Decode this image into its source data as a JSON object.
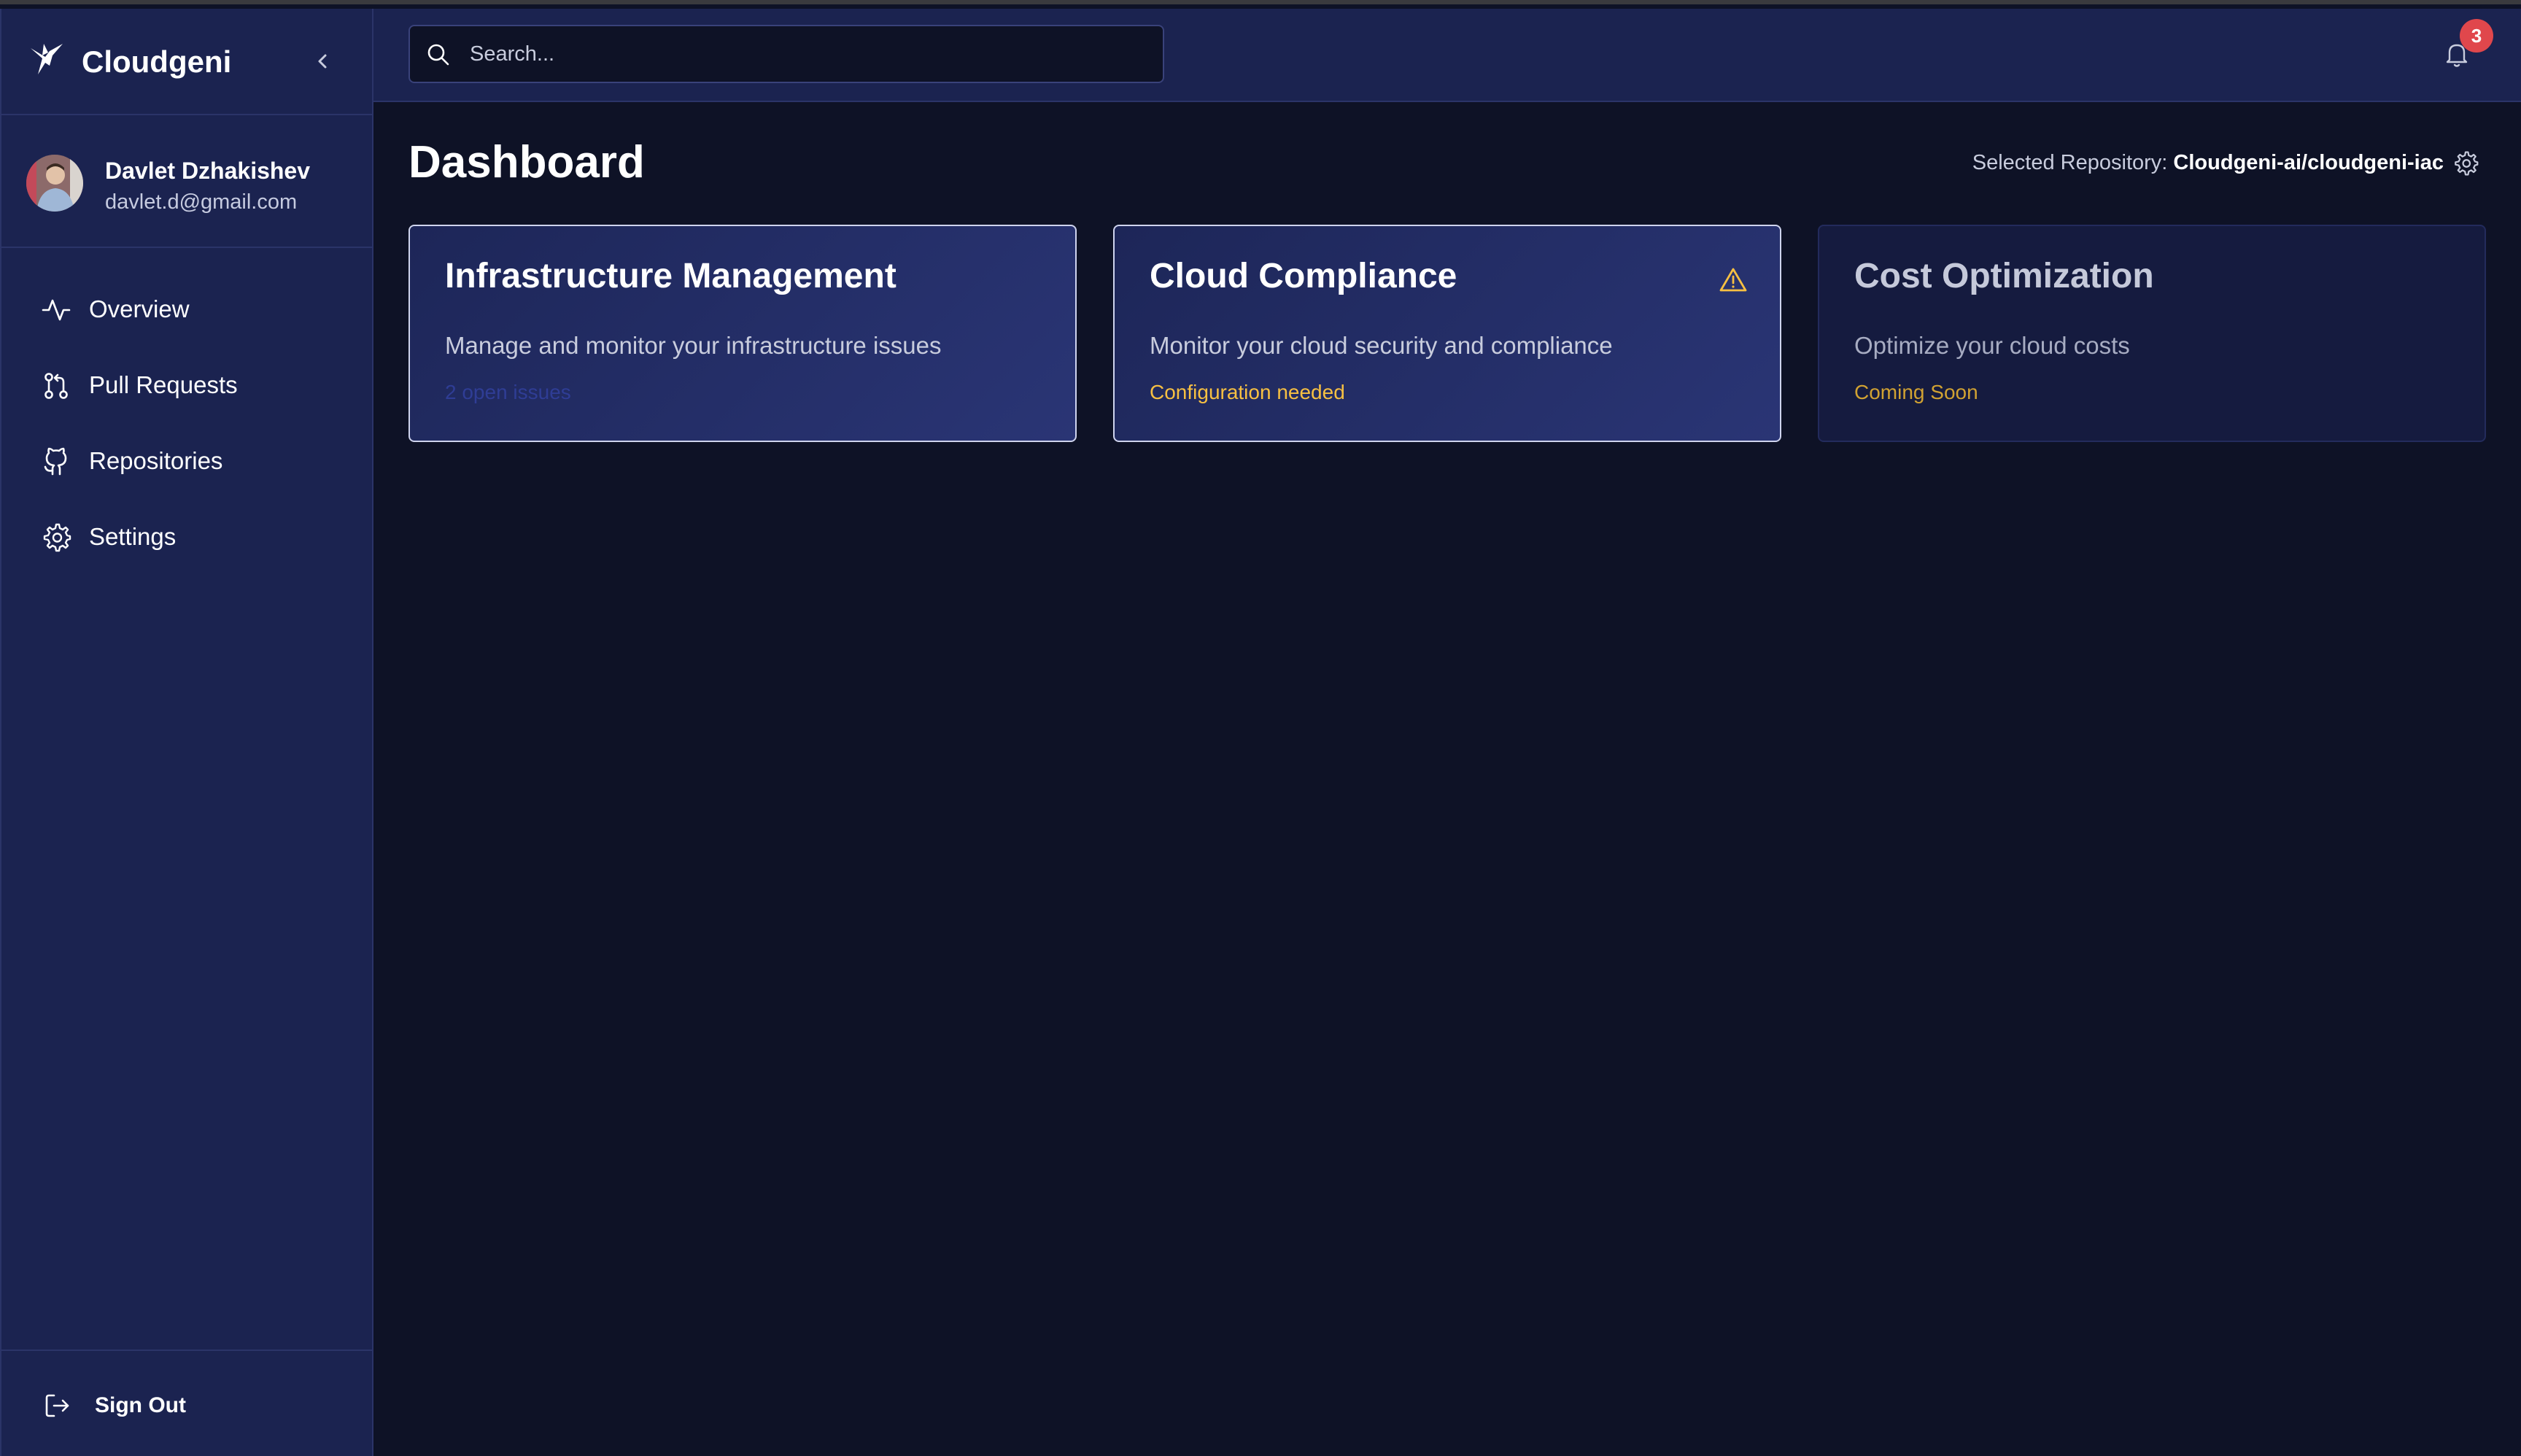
{
  "app": {
    "name": "Cloudgeni"
  },
  "user": {
    "name": "Davlet Dzhakishev",
    "email": "davlet.d@gmail.com"
  },
  "sidebar": {
    "items": [
      {
        "label": "Overview",
        "icon": "activity-icon"
      },
      {
        "label": "Pull Requests",
        "icon": "git-pull-request-icon"
      },
      {
        "label": "Repositories",
        "icon": "github-icon"
      },
      {
        "label": "Settings",
        "icon": "gear-icon"
      }
    ],
    "sign_out_label": "Sign Out"
  },
  "header": {
    "search_placeholder": "Search...",
    "notification_count": "3"
  },
  "main": {
    "title": "Dashboard",
    "repository_label": "Selected Repository:",
    "repository_value": "Cloudgeni-ai/cloudgeni-iac",
    "cards": [
      {
        "title": "Infrastructure Management",
        "description": "Manage and monitor your infrastructure issues",
        "status": "2 open issues"
      },
      {
        "title": "Cloud Compliance",
        "description": "Monitor your cloud security and compliance",
        "status": "Configuration needed",
        "icon": "warning-icon"
      },
      {
        "title": "Cost Optimization",
        "description": "Optimize your cloud costs",
        "status": "Coming Soon"
      }
    ]
  },
  "colors": {
    "sidebar_bg": "#1b2350",
    "page_bg": "#0e1226",
    "warning": "#f7c042",
    "badge": "#e0474c"
  }
}
